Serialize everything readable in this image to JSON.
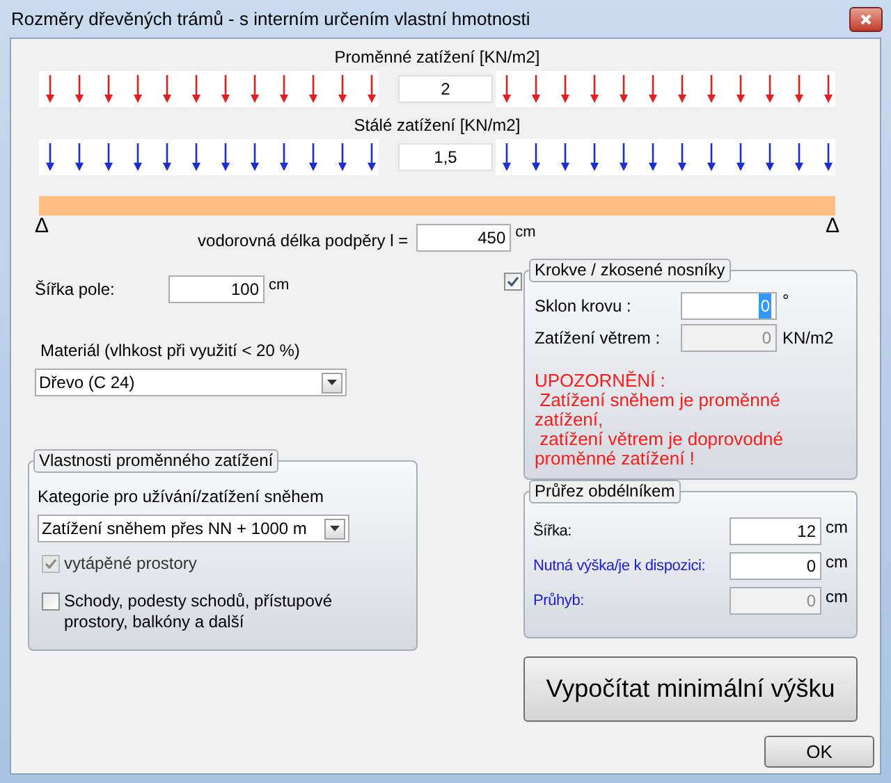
{
  "window": {
    "title": "Rozměry dřevěných trámů - s interním určením vlastní hmotnosti"
  },
  "loads": [
    {
      "label": "Proměnné zatížení [KN/m2]",
      "value": "2",
      "color": "#e02020"
    },
    {
      "label": "Stálé zatížení [KN/m2]",
      "value": "1,5",
      "color": "#1a2fd0"
    }
  ],
  "beam": {
    "support_left": "Δ",
    "support_right": "Δ",
    "length_label": "vodorovná délka podpěry  l =",
    "length_value": "450",
    "length_unit": "cm"
  },
  "field_width": {
    "label": "Šířka pole:",
    "value": "100",
    "unit": "cm"
  },
  "material": {
    "label": "Materiál (vlhkost při využití < 20 %)",
    "value": "Dřevo (C 24)"
  },
  "variable_load_group": {
    "title": "Vlastnosti proměnného zatížení",
    "category_label": "Kategorie pro užívání/zatížení sněhem",
    "category_value": "Zatížení sněhem přes NN + 1000 m",
    "options": [
      {
        "label": "vytápěné prostory",
        "checked": true,
        "disabled": true
      },
      {
        "label": "Schody, podesty schodů, přístupové prostory, balkóny a další",
        "checked": false,
        "disabled": false
      }
    ]
  },
  "rafters_group": {
    "enabled": true,
    "title": "Krokve / zkosené nosníky",
    "fields": [
      {
        "label": "Sklon krovu :",
        "value": "0",
        "unit": "°",
        "disabled": false,
        "focused": true
      },
      {
        "label": "Zatížení větrem :",
        "value": "0",
        "unit": "KN/m2",
        "disabled": true,
        "focused": false
      }
    ],
    "warning_title": "UPOZORNĚNÍ :",
    "warning_lines": [
      " Zatížení sněhem je proměnné zatížení,",
      " zatížení větrem je doprovodné proměnné zatížení !"
    ]
  },
  "section_group": {
    "title": "Průřez obdélníkem",
    "fields": [
      {
        "label": "Šířka:",
        "value": "12",
        "unit": "cm",
        "disabled": false,
        "color": "#000000"
      },
      {
        "label": "Nutná výška/je k dispozici:",
        "value": "0",
        "unit": "cm",
        "disabled": false,
        "color": "#1a1ae6"
      },
      {
        "label": "Průhyb:",
        "value": "0",
        "unit": "cm",
        "disabled": true,
        "color": "#1a1ae6"
      }
    ]
  },
  "calculate_button": "Vypočítat minimální výšku",
  "ok_button": "OK"
}
